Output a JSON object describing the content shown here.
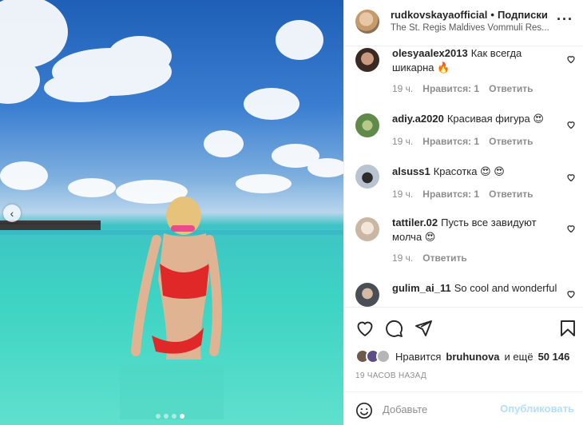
{
  "post": {
    "username": "rudkovskayaofficial",
    "separator": "•",
    "follow_label": "Подписки",
    "location": "The St. Regis Maldives Vommuli Res...",
    "more_label": "···"
  },
  "comments": [
    {
      "user": "olesyaalex2013",
      "text": "Как всегда шикарна 🔥",
      "time": "19 ч.",
      "likes": "Нравится: 1",
      "reply": "Ответить",
      "avatar_color": "#3b2a24"
    },
    {
      "user": "adiy.a2020",
      "text": "Красивая фигура 😍",
      "time": "19 ч.",
      "likes": "Нравится: 1",
      "reply": "Ответить",
      "avatar_color": "#5f8a4a"
    },
    {
      "user": "alsuss1",
      "text": "Красотка 😍 😍",
      "time": "19 ч.",
      "likes": "Нравится: 1",
      "reply": "Ответить",
      "avatar_color": "#5d6c7a"
    },
    {
      "user": "tattiler.02",
      "text": "Пусть все завидуют молча 😍",
      "time": "19 ч.",
      "likes": "",
      "reply": "Ответить",
      "avatar_color": "#c9b7a4"
    },
    {
      "user": "gulim_ai_11",
      "text": "So cool and wonderful",
      "time": "",
      "likes": "",
      "reply": "",
      "avatar_color": "#4a4f57"
    }
  ],
  "likes": {
    "prefix": "Нравится",
    "user": "bruhunova",
    "middle": "и ещё",
    "count": "50 146"
  },
  "time_ago": "19 ЧАСОВ НАЗАД",
  "composer": {
    "placeholder": "Добавьте",
    "publish_label": "Опубликовать"
  },
  "carousel": {
    "total": 4,
    "active": 4
  },
  "icons": [
    "heart-icon",
    "comment-icon",
    "share-icon",
    "bookmark-icon",
    "emoji-icon",
    "chevron-left-icon",
    "more-icon"
  ],
  "colors": {
    "accent_disabled": "#b2dffc",
    "muted": "#8e8e8e",
    "text": "#262626"
  }
}
